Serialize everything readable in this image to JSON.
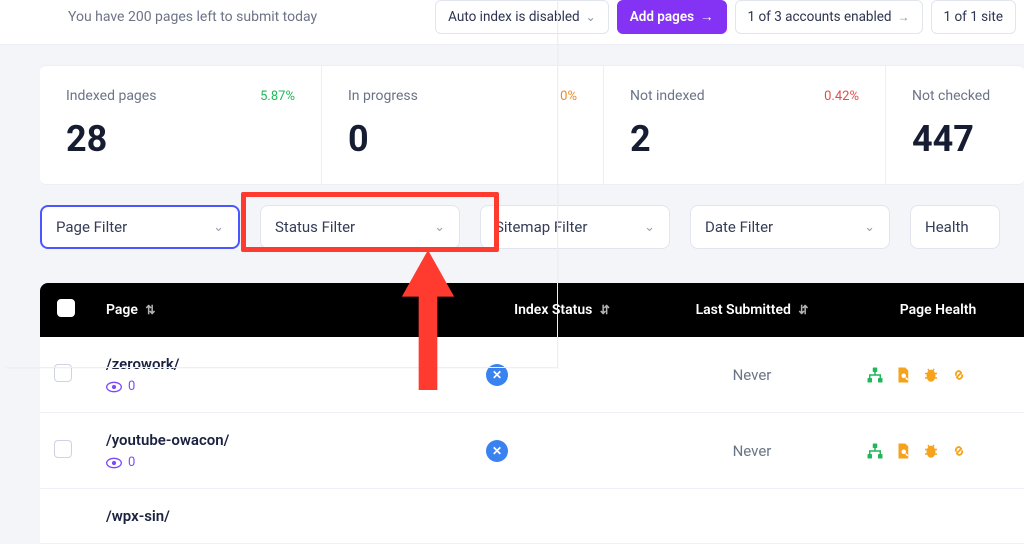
{
  "top": {
    "quota_text": "You have 200 pages left to submit today",
    "auto_index": "Auto index is disabled",
    "add_pages": "Add pages",
    "accounts": "1 of 3 accounts enabled",
    "sites": "1 of 1 site"
  },
  "stats": [
    {
      "label": "Indexed pages",
      "pct": "5.87%",
      "pct_cls": "green",
      "value": "28"
    },
    {
      "label": "In progress",
      "pct": "0%",
      "pct_cls": "orange",
      "value": "0"
    },
    {
      "label": "Not indexed",
      "pct": "0.42%",
      "pct_cls": "red",
      "value": "2"
    },
    {
      "label": "Not checked",
      "pct": "",
      "pct_cls": "",
      "value": "447"
    }
  ],
  "filters": {
    "page": "Page Filter",
    "status": "Status Filter",
    "sitemap": "Sitemap Filter",
    "date": "Date Filter",
    "health": "Health"
  },
  "table": {
    "cols": {
      "page": "Page",
      "index": "Index Status",
      "last": "Last Submitted",
      "health": "Page Health"
    },
    "rows": [
      {
        "path": "/zerowork/",
        "views": "0",
        "last": "Never"
      },
      {
        "path": "/youtube-owacon/",
        "views": "0",
        "last": "Never"
      },
      {
        "path": "/wpx-sin/",
        "views": "",
        "last": ""
      }
    ]
  }
}
